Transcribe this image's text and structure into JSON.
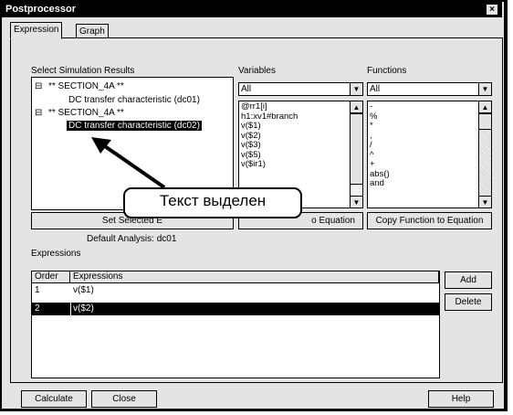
{
  "window": {
    "title": "Postprocessor",
    "close_glyph": "×"
  },
  "tabs": [
    {
      "label": "Expression"
    },
    {
      "label": "Graph"
    }
  ],
  "results": {
    "label": "Select Simulation Results",
    "tree": [
      {
        "label": "** SECTION_4A **",
        "toggle": "⊟"
      },
      {
        "label": "DC transfer characteristic (dc01)"
      },
      {
        "label": "** SECTION_4A **",
        "toggle": "⊟"
      },
      {
        "label": "DC transfer characteristic (dc02)"
      }
    ],
    "set_selected_label": "Set Selected E",
    "default_analysis": "Default Analysis: dc01"
  },
  "variables": {
    "label": "Variables",
    "filter": "All",
    "items": [
      "@rr1[i]",
      "h1:xv1#branch",
      "v($1)",
      "v($2)",
      "v($3)",
      "v($5)",
      "v($ir1)"
    ],
    "copy_label": "o Equation"
  },
  "functions": {
    "label": "Functions",
    "filter": "All",
    "items": [
      "-",
      "%",
      "*",
      ",",
      "/",
      "^",
      "+",
      "abs()",
      "and"
    ],
    "copy_label": "Copy Function to Equation"
  },
  "expressions": {
    "label": "Expressions",
    "columns": [
      "Order",
      "Expressions"
    ],
    "rows": [
      {
        "order": "1",
        "expr": "v($1)"
      },
      {
        "order": "2",
        "expr": "v($2)"
      }
    ],
    "add_label": "Add",
    "delete_label": "Delete"
  },
  "callout": {
    "text": "Текст выделен"
  },
  "footer": {
    "calculate_label": "Calculate",
    "close_label": "Close",
    "help_label": "Help"
  }
}
